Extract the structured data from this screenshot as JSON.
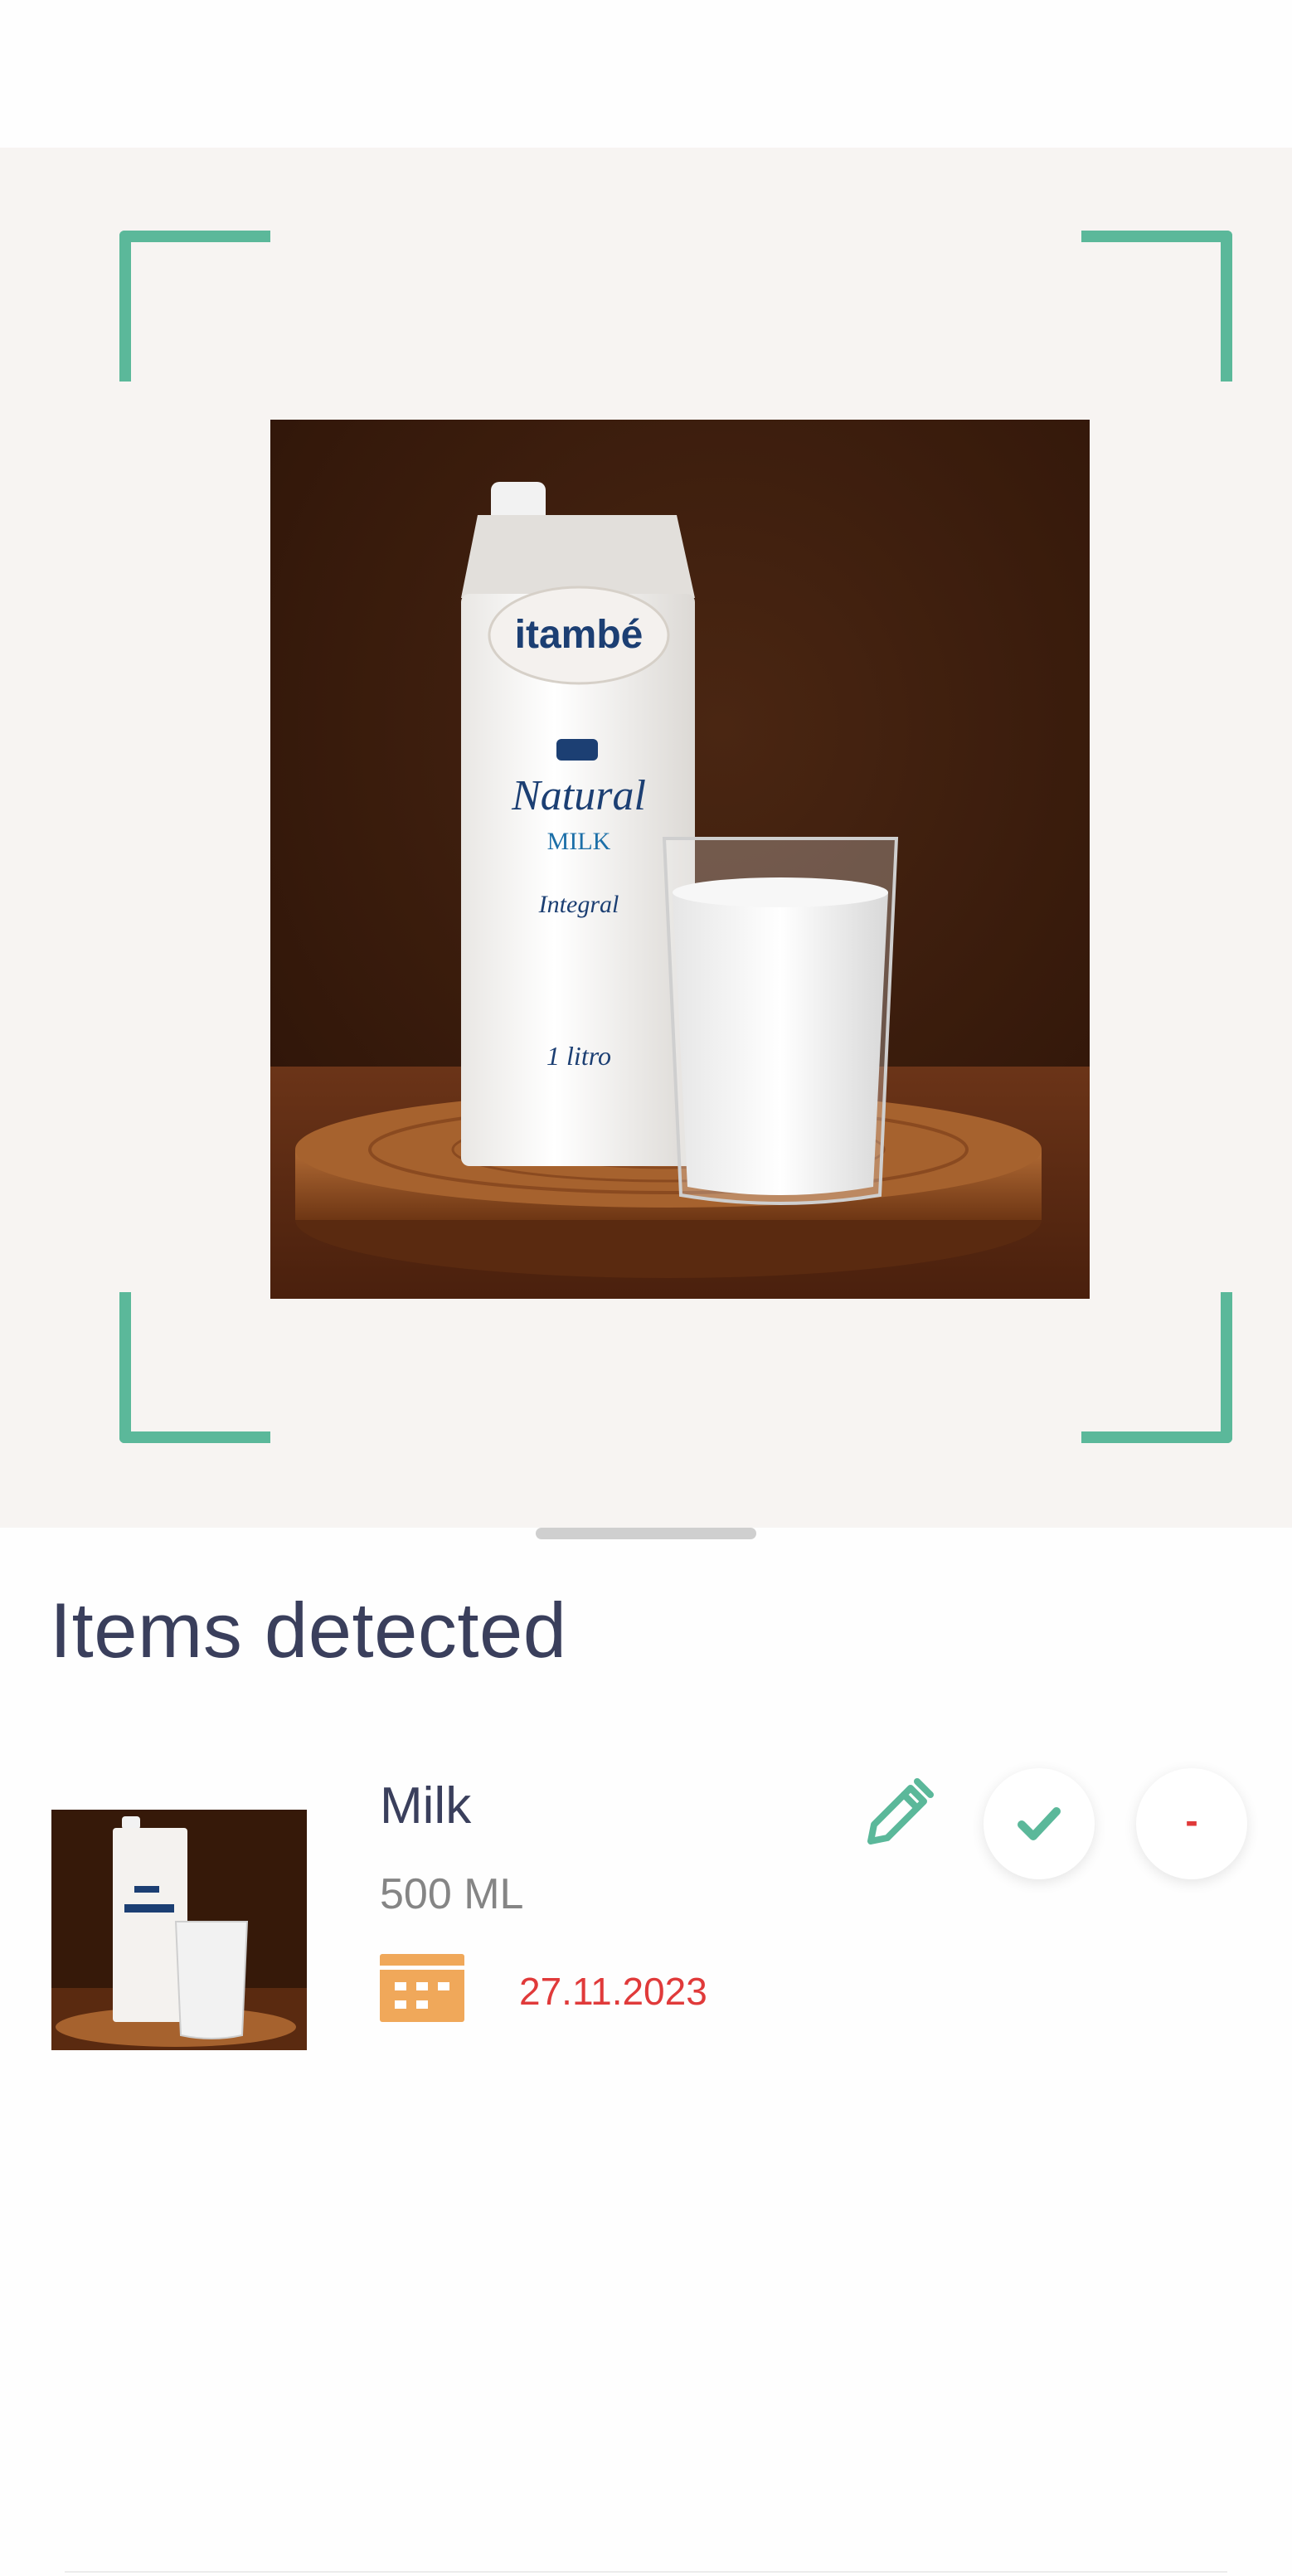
{
  "scanner": {
    "photo_alt": "Photo of a milk carton and a glass of milk",
    "carton_brand": "itambé",
    "carton_product": "Natural",
    "carton_type": "MILK",
    "carton_variant": "Integral",
    "carton_volume": "1 litro",
    "frame_color": "#5bb89a"
  },
  "panel": {
    "title": "Items detected"
  },
  "items": [
    {
      "name": "Milk",
      "quantity": "500 ML",
      "expiry_date": "27.11.2023",
      "icons": {
        "calendar": "calendar-icon",
        "edit": "pencil-icon",
        "confirm": "check-icon",
        "remove": "minus-icon"
      },
      "remove_label": "-"
    }
  ],
  "colors": {
    "accent": "#5bb89a",
    "title": "#3a3f5c",
    "date": "#e03a3a",
    "calendar": "#f0a85a"
  }
}
